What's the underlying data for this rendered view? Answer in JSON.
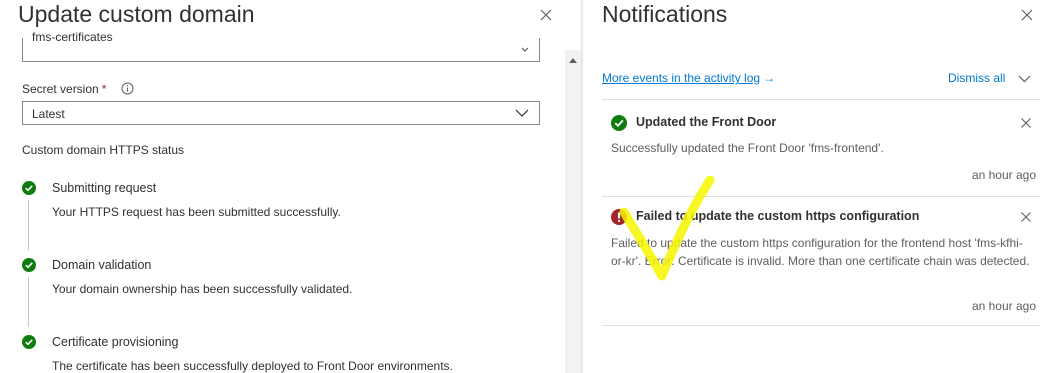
{
  "left_panel": {
    "title": "Update custom domain",
    "certificate_value": "fms-certificates",
    "secret_version_label": "Secret version",
    "required_mark": "*",
    "secret_version_value": "Latest",
    "https_status_label": "Custom domain HTTPS status",
    "steps": [
      {
        "title": "Submitting request",
        "description": "Your HTTPS request has been submitted successfully."
      },
      {
        "title": "Domain validation",
        "description": "Your domain ownership has been successfully validated."
      },
      {
        "title": "Certificate provisioning",
        "description": "The certificate has been successfully deployed to Front Door environments."
      }
    ]
  },
  "notifications_panel": {
    "title": "Notifications",
    "activity_log_link": "More events in the activity log",
    "activity_log_arrow": "→",
    "dismiss_all": "Dismiss all",
    "items": [
      {
        "status": "success",
        "title": "Updated the Front Door",
        "body": "Successfully updated the Front Door 'fms-frontend'.",
        "time": "an hour ago"
      },
      {
        "status": "error",
        "title": "Failed to update the custom https configuration",
        "body": "Failed to update the custom https configuration for the frontend host 'fms-kfhi-or-kr'. Error: Certificate is invalid. More than one certificate chain was detected.",
        "time": "an hour ago"
      }
    ]
  },
  "colors": {
    "accent": "#0078d4",
    "success": "#107c10",
    "error": "#a4262c",
    "annotation": "#f6f600"
  }
}
